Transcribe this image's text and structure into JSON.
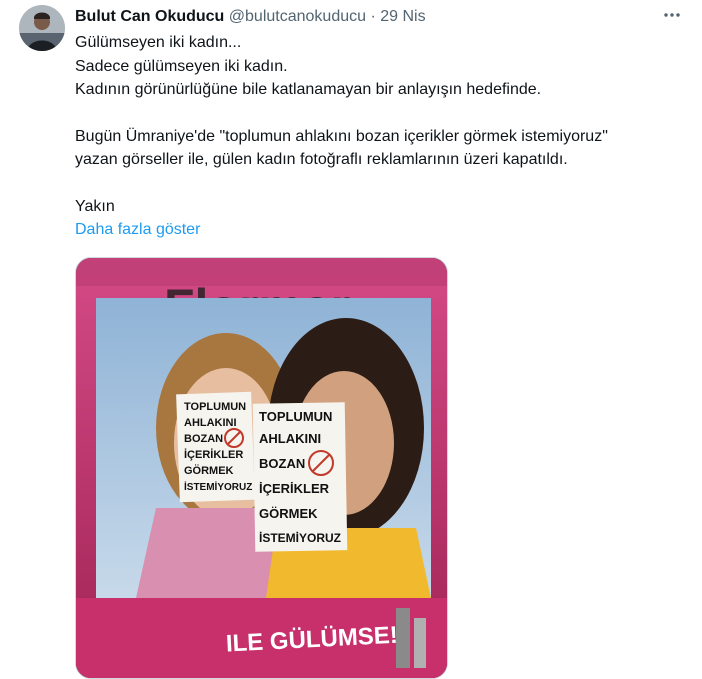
{
  "tweet": {
    "author_name": "Bulut Can Okuducu",
    "handle": "@bulutcanokuducu",
    "separator": "·",
    "date": "29 Nis",
    "more_icon": "more-horizontal-icon",
    "lines": [
      "Gülümseyen iki kadın...",
      "Sadece gülümseyen iki kadın.",
      "Kadının görünürlüğüne bile katlanamayan bir anlayışın hedefinde.",
      "",
      "Bugün Ümraniye'de \"toplumun ahlakını bozan içerikler görmek istemiyoruz\"",
      "yazan görseller ile, gülen kadın fotoğraflı reklamlarının üzeri kapatıldı.",
      "",
      "Yakın"
    ],
    "show_more": "Daha fazla göster"
  },
  "image": {
    "brand_text": "Flormar",
    "bottom_text": "ILE GÜLÜMSE!",
    "sticker_left": [
      "TOPLUMUN",
      "AHLAKINI",
      "BOZAN",
      "İÇERİKLER",
      "GÖRMEK",
      "İSTEMİYORUZ"
    ],
    "sticker_right": [
      "TOPLUMUN",
      "AHLAKINI",
      "BOZAN",
      "İÇERİKLER",
      "GÖRMEK",
      "İSTEMİYORUZ"
    ]
  },
  "colors": {
    "link": "#1d9bf0",
    "muted": "#536471",
    "text": "#0f1419",
    "poster_pink": "#c7306b"
  }
}
